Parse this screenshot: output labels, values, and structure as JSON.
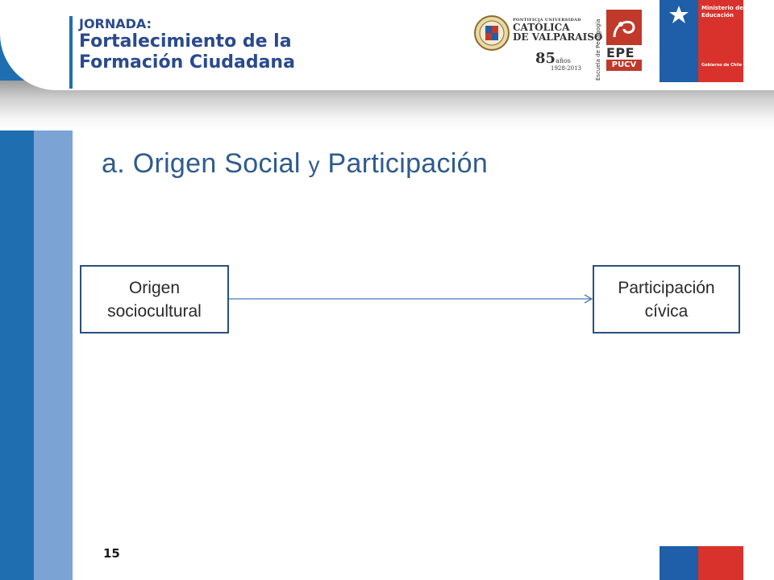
{
  "header": {
    "label": "JORNADA:",
    "title_line1": "Fortalecimiento de la",
    "title_line2": "Formación Ciudadana",
    "pucv": {
      "small": "PONTIFICIA UNIVERSIDAD",
      "line1": "CATÓLICA",
      "line2": "DE VALPARAISO",
      "years_num": "85",
      "years_word": "años",
      "years_range": "1928-2013"
    },
    "epe": {
      "vertical": "Escuela de Pedagogía",
      "name": "EPE",
      "sub": "PUCV"
    },
    "ministry": {
      "line1": "Ministerio de",
      "line2": "Educación",
      "gov": "Gobierno de Chile"
    }
  },
  "slide": {
    "title_main": "a. Origen Social ",
    "title_y": "y",
    "title_rest": " Participación"
  },
  "diagram": {
    "source": {
      "line1": "Origen",
      "line2": "sociocultural"
    },
    "target": {
      "line1": "Participación",
      "line2": "cívica"
    }
  },
  "footer": {
    "page_number": "15"
  },
  "colors": {
    "blue_dark": "#1f6fb0",
    "blue_light": "#7ba3d4",
    "title_blue": "#2f5b8e",
    "box_border": "#2b4f7e",
    "arrow": "#4a7bb5",
    "chile_blue": "#1f5ea8",
    "chile_red": "#d9312b"
  }
}
